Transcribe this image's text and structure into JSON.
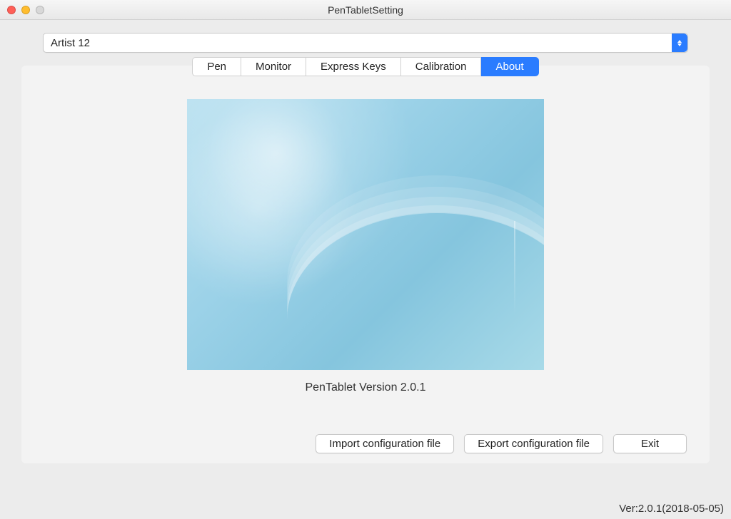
{
  "window": {
    "title": "PenTabletSetting"
  },
  "dropdown": {
    "selected": "Artist 12"
  },
  "tabs": {
    "pen": "Pen",
    "monitor": "Monitor",
    "express": "Express Keys",
    "calibration": "Calibration",
    "about": "About"
  },
  "about": {
    "version_label": "PenTablet Version  2.0.1"
  },
  "buttons": {
    "import": "Import configuration file",
    "export": "Export configuration file",
    "exit": "Exit"
  },
  "footer": {
    "ver": "Ver:2.0.1(2018-05-05)"
  }
}
